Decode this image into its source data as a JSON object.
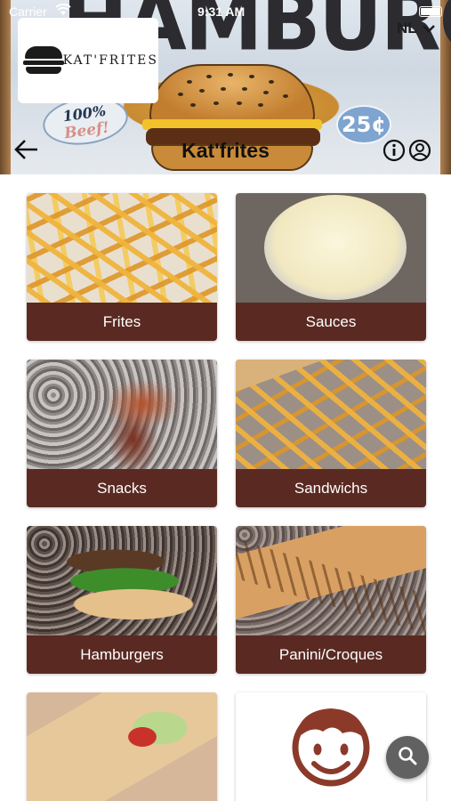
{
  "status_bar": {
    "carrier": "Carrier",
    "time": "9:31 AM"
  },
  "header": {
    "banner_text": "HAMBURGERS",
    "badge_line1": "100%",
    "badge_line2": "Beef!",
    "price_badge": "25¢",
    "logo_text": "KAT'FRITES",
    "language": "NL",
    "title": "Kat'frites"
  },
  "categories": [
    {
      "label": "Frites",
      "photo": "fries"
    },
    {
      "label": "Sauces",
      "photo": "sauce-cup"
    },
    {
      "label": "Snacks",
      "photo": "snack"
    },
    {
      "label": "Sandwichs",
      "photo": "sandwich-with-fries"
    },
    {
      "label": "Hamburgers",
      "photo": "hamburger"
    },
    {
      "label": "Panini/Croques",
      "photo": "panini"
    },
    {
      "label": "",
      "photo": "wrap"
    },
    {
      "label": "",
      "photo": "smiley-face-logo"
    }
  ],
  "colors": {
    "label_bar": "#5a2a22",
    "fab": "#616161",
    "face": "#8b3a2a"
  },
  "icons": {
    "back": "back-arrow-icon",
    "info": "info-icon",
    "user": "user-icon",
    "chevron": "chevron-down-icon",
    "search": "search-icon"
  }
}
